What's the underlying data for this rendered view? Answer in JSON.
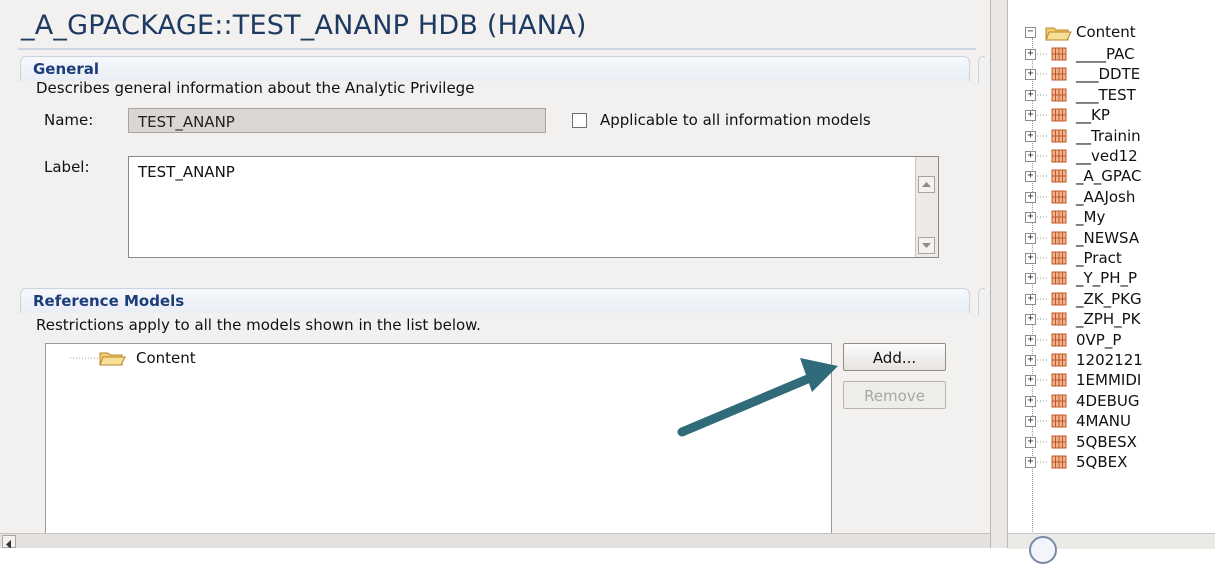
{
  "editor": {
    "title": "_A_GPACKAGE::TEST_ANANP HDB (HANA)"
  },
  "general": {
    "header": "General",
    "description": "Describes general information about the Analytic Privilege",
    "name_label": "Name:",
    "name_value": "TEST_ANANP",
    "applicable_label": "Applicable to all information models",
    "applicable_checked": false,
    "label_label": "Label:",
    "label_value": "TEST_ANANP"
  },
  "reference_models": {
    "header": "Reference Models",
    "description": "Restrictions apply to all the models shown in the list below.",
    "tree_root": "Content",
    "add_button": "Add...",
    "remove_button": "Remove"
  },
  "navigator": {
    "root": "Content",
    "items": [
      "____PAC",
      "___DDTE",
      "___TEST",
      "__KP",
      "__Trainin",
      "__ved12",
      "_A_GPAC",
      "_AAJosh",
      "_My",
      "_NEWSA",
      "_Pract",
      "_Y_PH_P",
      "_ZK_PKG",
      "_ZPH_PK",
      "0VP_P",
      "1202121",
      "1EMMIDI",
      "4DEBUG",
      "4MANU",
      "5QBESX",
      "5QBEX"
    ]
  },
  "colors": {
    "title": "#1d3a63",
    "section_header": "#1b3d79",
    "arrow": "#2f6b78",
    "package_icon": "#c0572a",
    "folder_icon": "#e9b84a"
  },
  "icons": {
    "folder": "folder-open-icon",
    "package": "package-icon",
    "expand": "tree-expand-icon",
    "collapse": "tree-collapse-icon",
    "pointer": "annotation-arrow-icon",
    "help": "help-icon"
  }
}
